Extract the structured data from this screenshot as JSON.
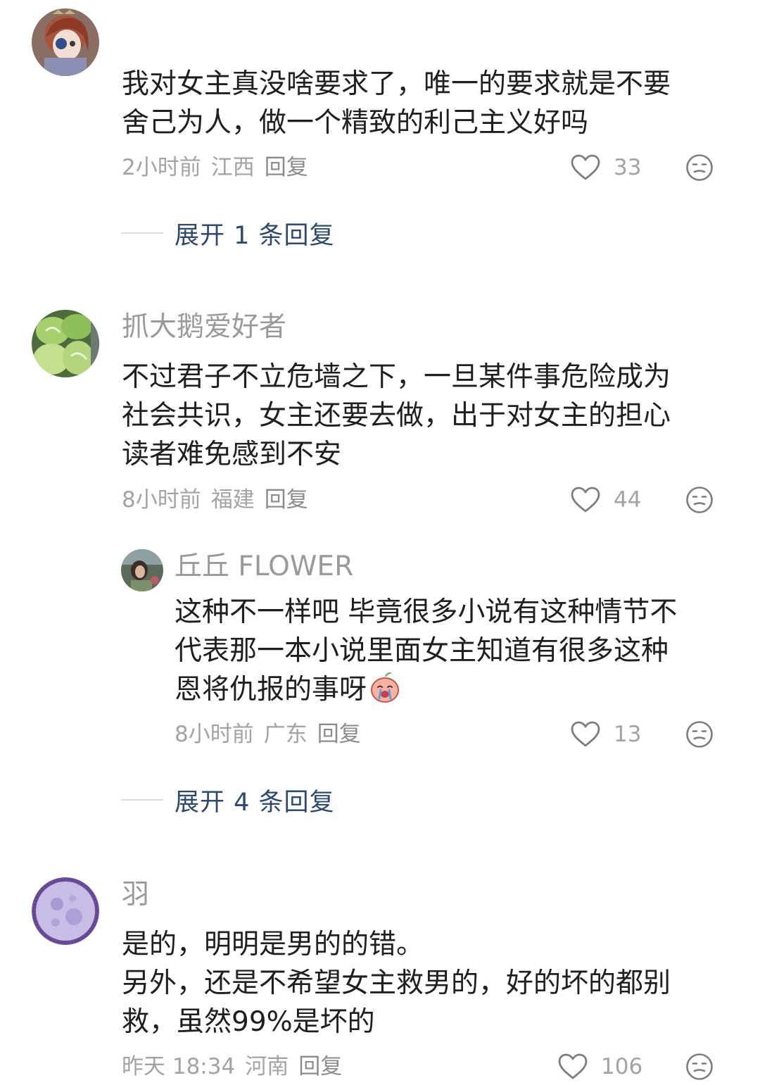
{
  "comments": [
    {
      "name": "",
      "text": "我对女主真没啥要求了，唯一的要求就是不要\n舍己为人，做一个精致的利己主义好吗",
      "time": "2小时前",
      "location": "江西",
      "reply_label": "回复",
      "likes": "33",
      "expand_label": "展开 1 条回复"
    },
    {
      "name": "抓大鹅爱好者",
      "text": "不过君子不立危墙之下，一旦某件事危险成为\n社会共识，女主还要去做，出于对女主的担心\n读者难免感到不安",
      "time": "8小时前",
      "location": "福建",
      "reply_label": "回复",
      "likes": "44",
      "reply": {
        "name": "丘丘 FLOWER",
        "text": "这种不一样吧 毕竟很多小说有这种情节不\n代表那一本小说里面女主知道有很多这种\n恩将仇报的事呀",
        "time": "8小时前",
        "location": "广东",
        "reply_label": "回复",
        "likes": "13"
      },
      "expand_label": "展开 4 条回复"
    },
    {
      "name": "羽",
      "text": "是的，明明是男的的错。\n另外，还是不希望女主救男的，好的坏的都别\n救，虽然99%是坏的",
      "time": "昨天 18:34",
      "location": "河南",
      "reply_label": "回复",
      "likes": "106"
    }
  ],
  "colors": {
    "expand_text": "#2d4a6e",
    "meta_text": "#a3a3a3",
    "body_text": "#1f1f1f",
    "name_text": "#9a9a9a"
  },
  "icons": {
    "like": "heart-outline-icon",
    "dislike": "meh-face-icon",
    "emoji": "crying-peach-emoji"
  }
}
